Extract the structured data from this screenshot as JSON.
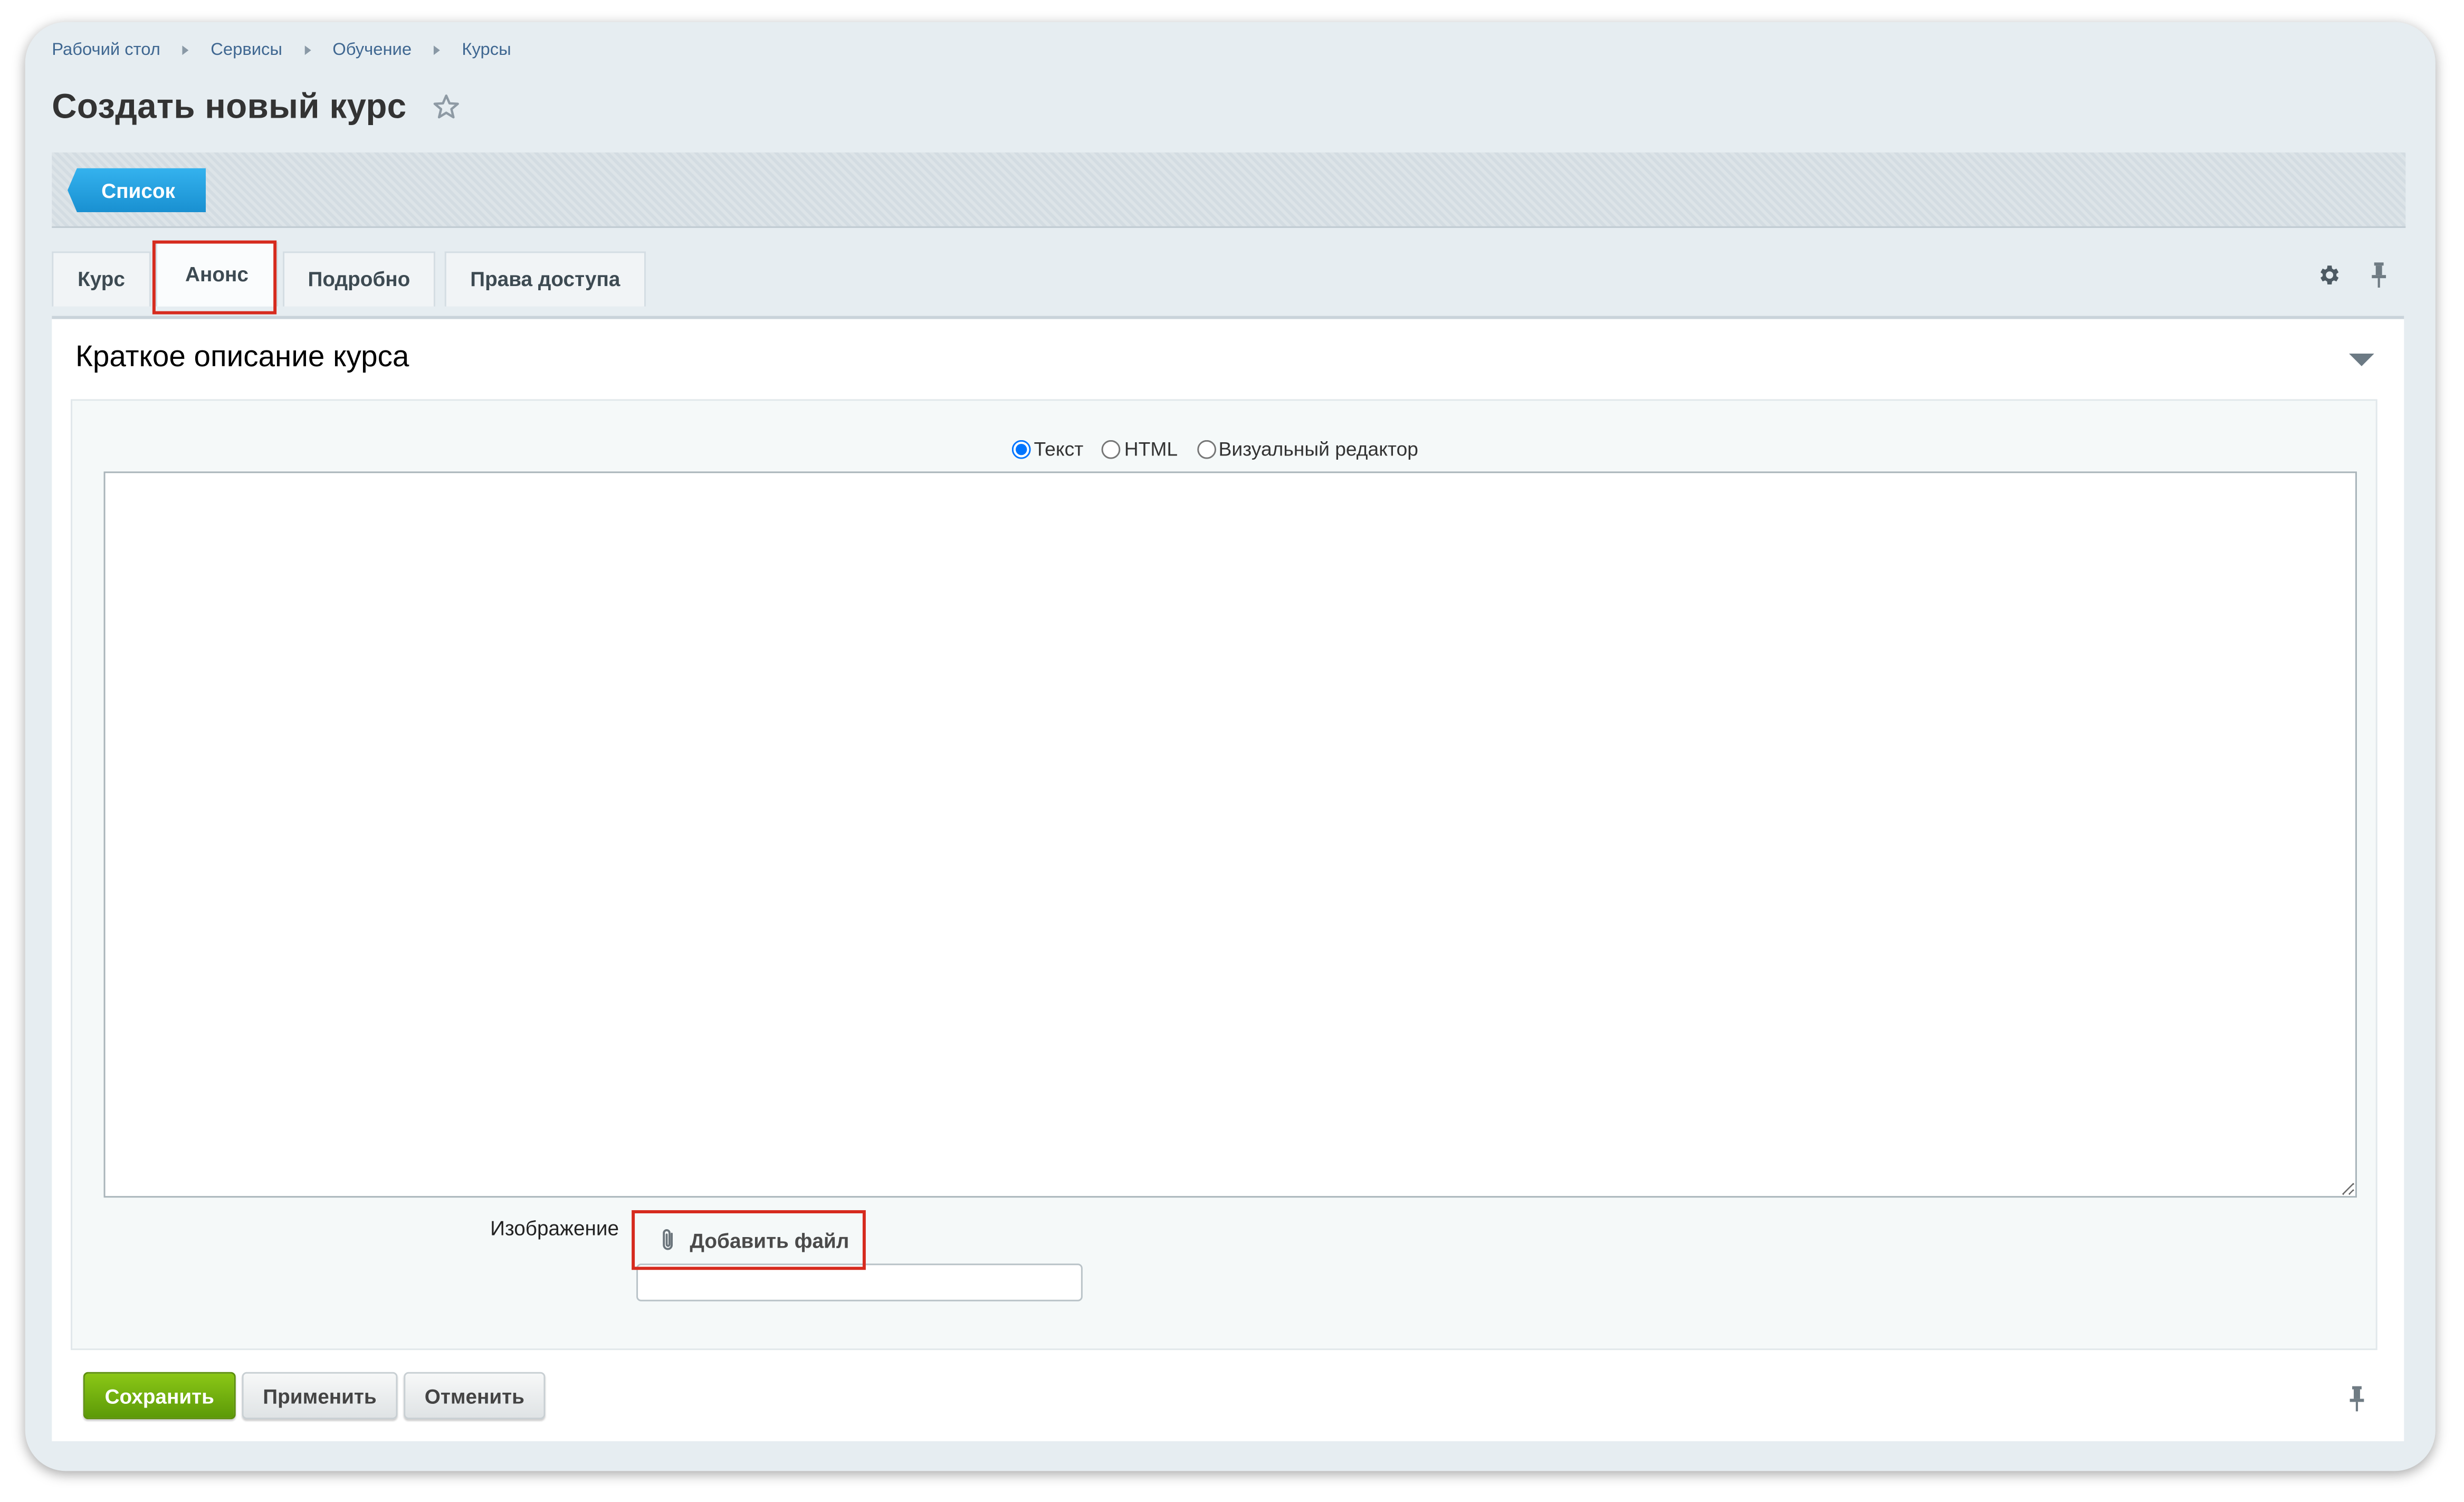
{
  "breadcrumb": {
    "items": [
      "Рабочий стол",
      "Сервисы",
      "Обучение",
      "Курсы"
    ]
  },
  "page": {
    "title": "Создать новый курс"
  },
  "toolbar": {
    "list_label": "Список"
  },
  "tabs": [
    {
      "label": "Курс",
      "active": false
    },
    {
      "label": "Анонс",
      "active": true
    },
    {
      "label": "Подробно",
      "active": false
    },
    {
      "label": "Права доступа",
      "active": false
    }
  ],
  "section": {
    "title": "Краткое описание курса"
  },
  "editor": {
    "modes": [
      "Текст",
      "HTML",
      "Визуальный редактор"
    ],
    "selected_mode": "Текст",
    "text_value": ""
  },
  "image": {
    "label": "Изображение",
    "add_file_label": "Добавить файл",
    "file_value": ""
  },
  "footer": {
    "save_label": "Сохранить",
    "apply_label": "Применить",
    "cancel_label": "Отменить"
  },
  "colors": {
    "accent_blue": "#1e9ee0",
    "save_green": "#6fae0e",
    "highlight_red": "#d62b1e",
    "link_blue": "#3f6791"
  },
  "icons": {
    "title_star": "star-icon",
    "settings": "gear-icon",
    "pin": "pin-icon",
    "collapse": "chevron-down-icon",
    "attachment": "paperclip-icon"
  }
}
